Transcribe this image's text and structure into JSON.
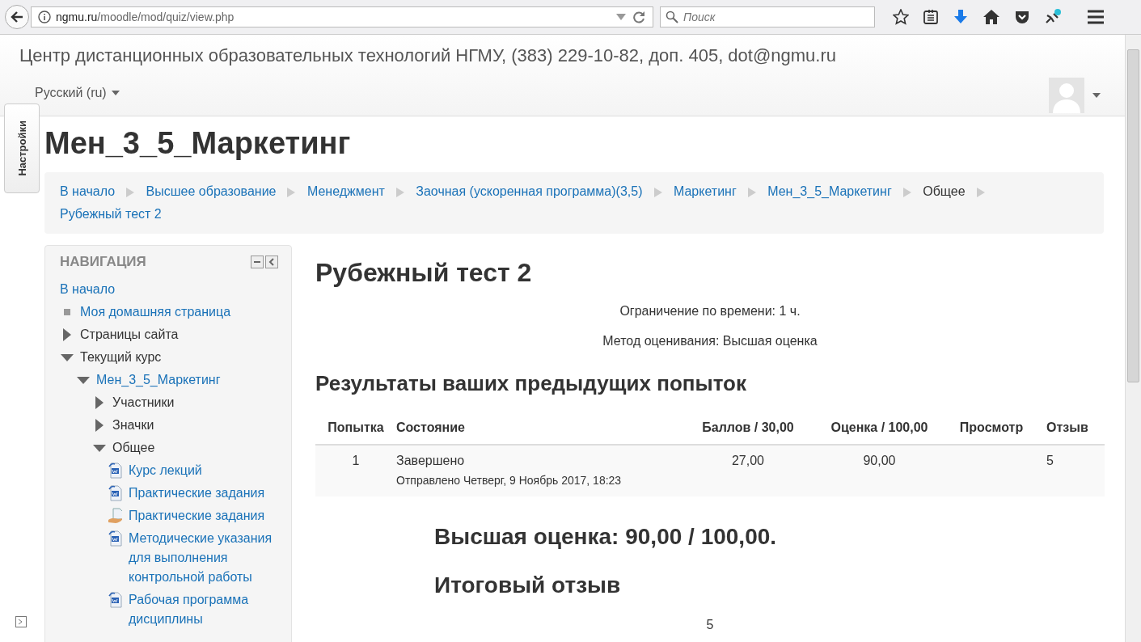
{
  "browser": {
    "url_host": "ngmu.ru",
    "url_path": "/moodle/mod/quiz/view.php",
    "search_placeholder": "Поиск"
  },
  "header": {
    "site_title": "Центр дистанционных образовательных технологий НГМУ, (383) 229-10-82, доп. 405, dot@ngmu.ru",
    "language": "Русский (ru)"
  },
  "settings_tab": "Настройки",
  "page_title": "Мен_3_5_Маркетинг",
  "breadcrumb": [
    {
      "label": "В начало",
      "link": true
    },
    {
      "label": "Высшее образование",
      "link": true
    },
    {
      "label": "Менеджмент",
      "link": true
    },
    {
      "label": "Заочная (ускоренная программа)(3,5)",
      "link": true
    },
    {
      "label": "Маркетинг",
      "link": true
    },
    {
      "label": "Мен_3_5_Маркетинг",
      "link": true
    },
    {
      "label": "Общее",
      "link": false
    },
    {
      "label": "Рубежный тест 2",
      "link": true
    }
  ],
  "navigation": {
    "title": "НАВИГАЦИЯ",
    "items": [
      {
        "label": "В начало",
        "kind": "root",
        "link": true
      },
      {
        "label": "Моя домашняя страница",
        "kind": "bullet",
        "link": true
      },
      {
        "label": "Страницы сайта",
        "kind": "branch",
        "expanded": false,
        "link": false
      },
      {
        "label": "Текущий курс",
        "kind": "branch",
        "expanded": true,
        "link": false,
        "children": [
          {
            "label": "Мен_3_5_Маркетинг",
            "kind": "branch",
            "expanded": true,
            "link": true,
            "children": [
              {
                "label": "Участники",
                "kind": "branch",
                "expanded": false,
                "link": false
              },
              {
                "label": "Значки",
                "kind": "branch",
                "expanded": false,
                "link": false
              },
              {
                "label": "Общее",
                "kind": "branch",
                "expanded": true,
                "link": false,
                "children": [
                  {
                    "label": "Курс лекций",
                    "kind": "document",
                    "link": true
                  },
                  {
                    "label": "Практические задания",
                    "kind": "document",
                    "link": true
                  },
                  {
                    "label": "Практические задания",
                    "kind": "assignment",
                    "link": true
                  },
                  {
                    "label": "Методические указания для выполнения контрольной работы",
                    "kind": "document",
                    "link": true
                  },
                  {
                    "label": "Рабочая программа дисциплины",
                    "kind": "document",
                    "link": true
                  }
                ]
              }
            ]
          }
        ]
      }
    ]
  },
  "quiz": {
    "title": "Рубежный тест 2",
    "info": [
      "Ограничение по времени: 1 ч.",
      "Метод оценивания: Высшая оценка"
    ],
    "results_title": "Результаты ваших предыдущих попыток",
    "table": {
      "columns": [
        "Попытка",
        "Состояние",
        "Баллов / 30,00",
        "Оценка / 100,00",
        "Просмотр",
        "Отзыв"
      ],
      "rows": [
        {
          "attempt": "1",
          "state": "Завершено",
          "submitted": "Отправлено Четверг, 9 Ноябрь 2017, 18:23",
          "points": "27,00",
          "grade": "90,00",
          "feedback": "5"
        }
      ]
    },
    "best_grade": "Высшая оценка: 90,00 / 100,00.",
    "final_feedback_title": "Итоговый отзыв",
    "final_feedback": "5"
  }
}
